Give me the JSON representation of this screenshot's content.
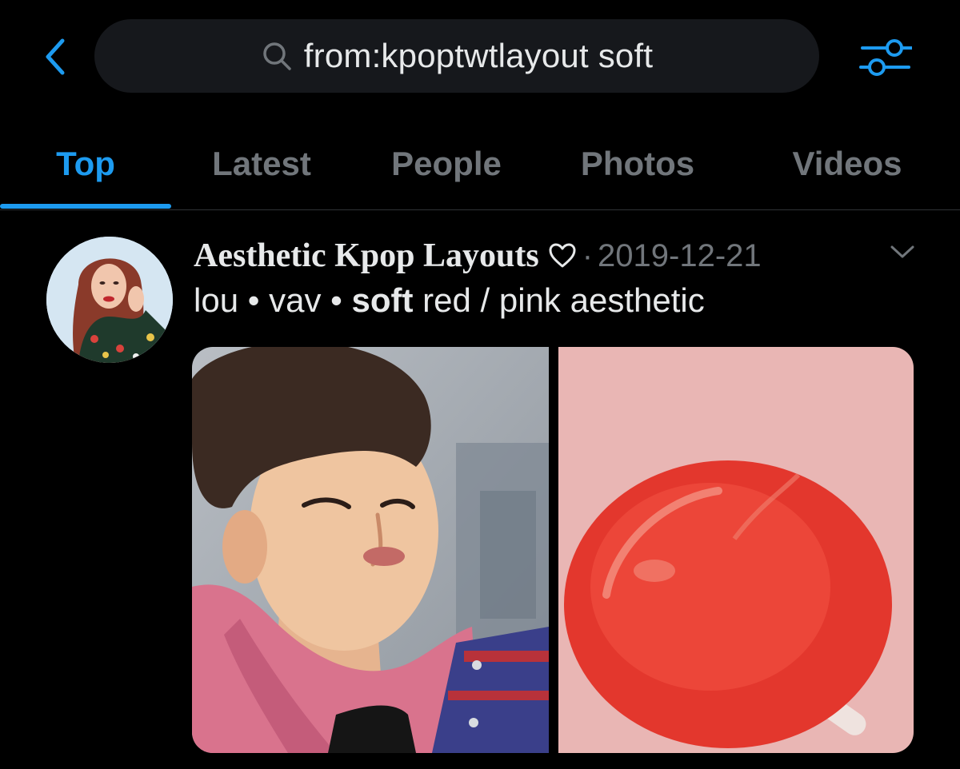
{
  "search": {
    "query": "from:kpoptwtlayout soft"
  },
  "icons": {
    "back": "chevron-left-icon",
    "search": "search-icon",
    "filter": "sliders-icon",
    "heart": "heart-outline-icon",
    "caret": "chevron-down-icon"
  },
  "tabs": [
    {
      "label": "Top",
      "active": true
    },
    {
      "label": "Latest",
      "active": false
    },
    {
      "label": "People",
      "active": false
    },
    {
      "label": "Photos",
      "active": false
    },
    {
      "label": "Videos",
      "active": false
    }
  ],
  "tweet": {
    "display_name": "Aesthetic Kpop Layouts",
    "separator": "·",
    "date": "2019-12-21",
    "text_prefix": "lou • vav • ",
    "text_highlight": "soft",
    "text_suffix": " red / pink aesthetic"
  },
  "colors": {
    "accent": "#1d9bf0",
    "background": "#000000",
    "secondary_text": "#71767b",
    "search_bg": "#16181c"
  }
}
